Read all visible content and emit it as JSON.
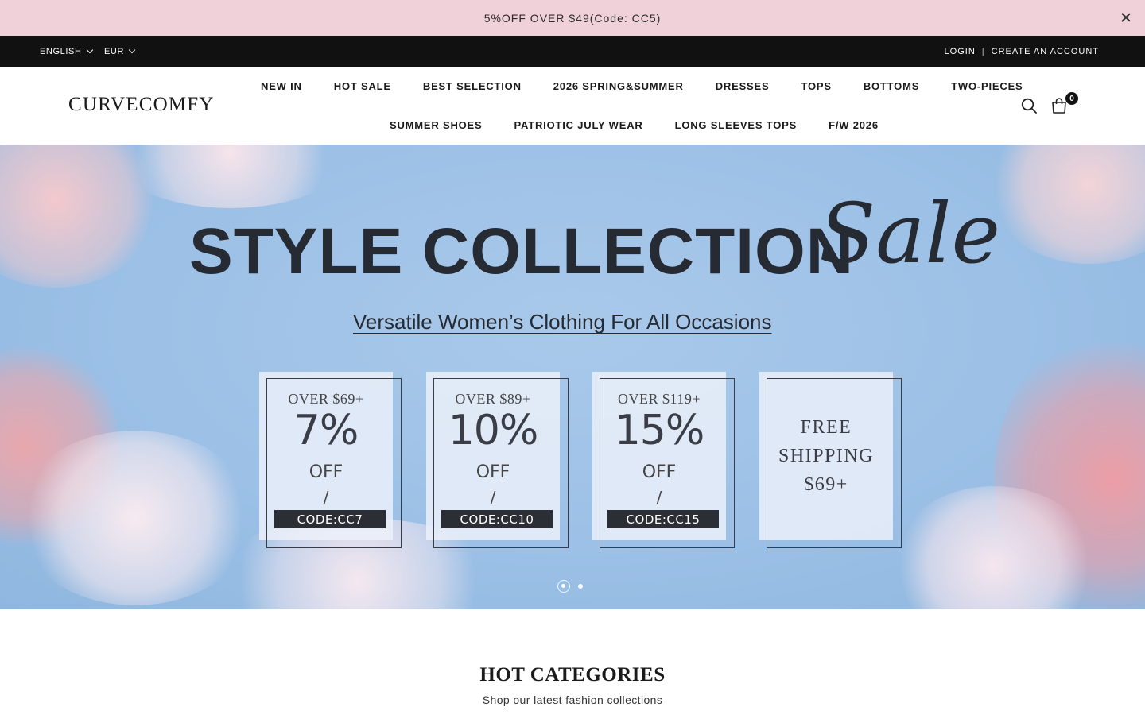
{
  "announcement": {
    "text": "5%OFF OVER $49(Code: CC5)"
  },
  "topbar": {
    "language": "ENGLISH",
    "currency": "EUR",
    "login": "LOGIN",
    "separator": "|",
    "create_account": "CREATE AN ACCOUNT"
  },
  "header": {
    "logo": "CURVECOMFY",
    "nav_row1": [
      "NEW IN",
      "HOT SALE",
      "BEST SELECTION",
      "2026 SPRING&SUMMER",
      "DRESSES",
      "TOPS",
      "BOTTOMS",
      "TWO-PIECES"
    ],
    "nav_row2": [
      "SUMMER SHOES",
      "PATRIOTIC JULY WEAR",
      "LONG SLEEVES TOPS",
      "F/W 2026"
    ],
    "cart_count": "0"
  },
  "hero": {
    "title": "STYLE COLLECTION",
    "script": "Sale",
    "subtitle": "Versatile Women’s Clothing For All Occasions",
    "cards": [
      {
        "over": "OVER $69+",
        "pct": "7%",
        "off": "OFF",
        "slash": "/",
        "code": "CODE:CC7"
      },
      {
        "over": "OVER $89+",
        "pct": "10%",
        "off": "OFF",
        "slash": "/",
        "code": "CODE:CC10"
      },
      {
        "over": "OVER $119+",
        "pct": "15%",
        "off": "OFF",
        "slash": "/",
        "code": "CODE:CC15"
      },
      {
        "free1": "FREE",
        "free2": "SHIPPING",
        "free3": "$69+"
      }
    ],
    "active_slide": 1,
    "slide_count": 2
  },
  "hot_categories": {
    "title": "HOT CATEGORIES",
    "subtitle": "Shop our latest fashion collections"
  },
  "colors": {
    "announcement_bg": "#f1d1d9",
    "topbar_bg": "#111111",
    "hero_sky": "#9cc0e6",
    "text_dark": "#252a33"
  }
}
